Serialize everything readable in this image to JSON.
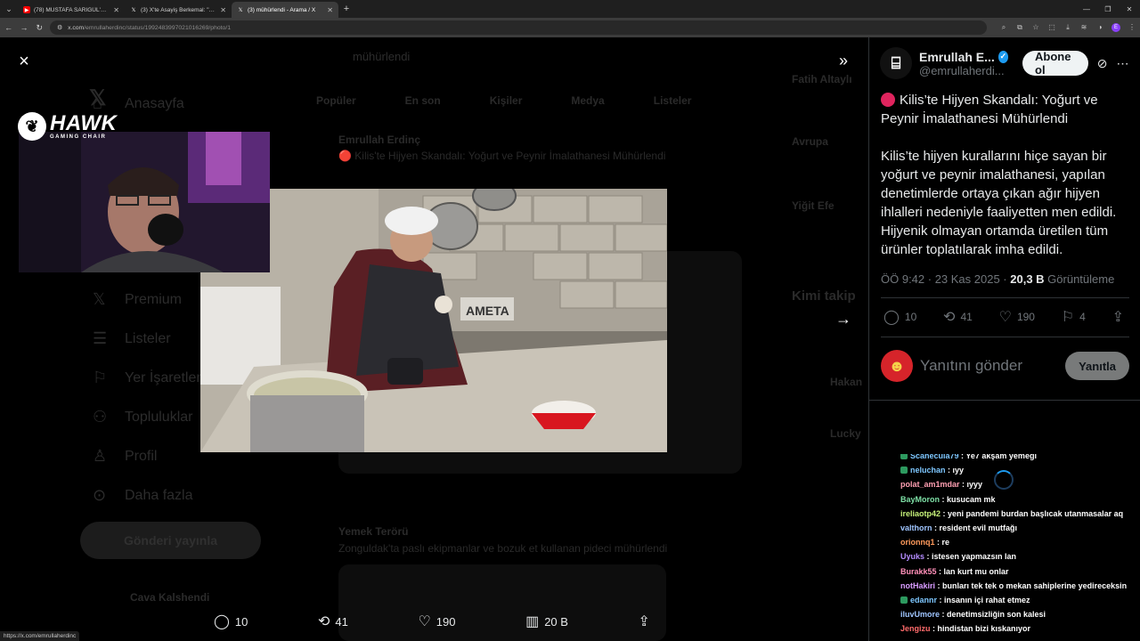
{
  "browser": {
    "tabs": [
      {
        "title": "(78) MUSTAFA SARIGÜL'ÜN EV",
        "favicon": "youtube-icon",
        "active": false
      },
      {
        "title": "(3) X'te Asayiş Berkemal: \"Zong",
        "favicon": "x-icon",
        "active": false
      },
      {
        "title": "(3) mühürlendi - Arama / X",
        "favicon": "x-icon",
        "active": true
      }
    ],
    "new_tab": "+",
    "url_host": "x.com",
    "url_path": "/emrullaherdinc/status/1992483997021016269/photo/1",
    "status_url": "https://x.com/emrullaherdinc"
  },
  "background": {
    "nav_items": [
      "Anasayfa",
      "Premium",
      "Listeler",
      "Yer İşaretleri",
      "Topluluklar",
      "Profil",
      "Daha fazla"
    ],
    "post_button": "Gönderi yayınla",
    "search_text": "mühürlendi",
    "tabs": [
      "Popüler",
      "En son",
      "Kişiler",
      "Medya",
      "Listeler"
    ],
    "tweet1_author": "Emrullah Erdinç",
    "tweet1_text": "🔴 Kilis'te Hijyen Skandalı: Yoğurt ve Peynir İmalathanesi Mühürlendi",
    "tweet2_author": "Yemek Terörü",
    "tweet2_text": "Zonguldak'ta paslı ekipmanlar ve bozuk et kullanan pideci mühürlendi",
    "right_items": [
      "Fatih Altaylı",
      "Avrupa",
      "Yiğit Efe",
      "Kimi takip",
      "Hakan",
      "Lucky"
    ],
    "account_name": "Cava Kalshendi"
  },
  "lightbox": {
    "close_label": "×",
    "expand_label": "»",
    "next_label": "→",
    "bottom": {
      "replies": "10",
      "reposts": "41",
      "likes": "190",
      "views": "20 B"
    }
  },
  "webcam": {
    "brand": "HAWK",
    "brand_sub": "GAMING CHAIR"
  },
  "tweet": {
    "author_name": "Emrullah E...",
    "author_handle": "@emrullaherdi...",
    "follow_label": "Abone ol",
    "title": "Kilis’te Hijyen Skandalı: Yoğurt ve Peynir İmalathanesi Mühürlendi",
    "body": "Kilis’te hijyen kurallarını hiçe sayan bir yoğurt ve peynir imalathanesi, yapılan denetimlerde ortaya çıkan ağır hijyen ihlalleri nedeniyle faaliyetten men edildi. Hijyenik olmayan ortamda üretilen tüm ürünler toplatılarak imha edildi.",
    "time": "ÖÖ 9:42 · 23 Kas 2025 · ",
    "views_count": "20,3 B",
    "views_label": " Görüntüleme",
    "replies": "10",
    "reposts": "41",
    "likes": "190",
    "bookmarks": "4",
    "reply_placeholder": "Yanıtını gönder",
    "reply_button": "Yanıtla"
  },
  "chat": [
    {
      "user": "Scanecula79",
      "text": "Ye7 akşam yemeği",
      "color": "#7ec7ff",
      "badge": true
    },
    {
      "user": "neluchan",
      "text": "ıyy",
      "color": "#7ec7ff",
      "badge": true
    },
    {
      "user": "polat_am1mdar",
      "text": "ıyyy",
      "color": "#ff9fb2",
      "badge": false
    },
    {
      "user": "BayMoron",
      "text": "kusucam mk",
      "color": "#7ee0a6",
      "badge": false
    },
    {
      "user": "ireliaotp42",
      "text": "yeni pandemi burdan başlıcak utanmasalar aq",
      "color": "#c7f27a",
      "badge": false
    },
    {
      "user": "valthorn",
      "text": "resident evil mutfağı",
      "color": "#9fc5ff",
      "badge": false
    },
    {
      "user": "orionnq1",
      "text": "re",
      "color": "#ff9a5c",
      "badge": false
    },
    {
      "user": "Uyuks",
      "text": "istesen yapmazsın lan",
      "color": "#b48cff",
      "badge": false
    },
    {
      "user": "Burakk55",
      "text": "lan kurt mu onlar",
      "color": "#ff8fb8",
      "badge": false
    },
    {
      "user": "notHakiri",
      "text": "bunları tek tek o mekan sahiplerine yedireceksin",
      "color": "#d89cff",
      "badge": false
    },
    {
      "user": "edannr",
      "text": "insanın içi rahat etmez",
      "color": "#7ec7ff",
      "badge": true
    },
    {
      "user": "iluvUmore",
      "text": "denetimsizliğin son kalesi",
      "color": "#9fc5ff",
      "badge": false
    },
    {
      "user": "Jengizu",
      "text": "hindistan bizi kıskanıyor",
      "color": "#ff6b6b",
      "badge": false
    }
  ]
}
